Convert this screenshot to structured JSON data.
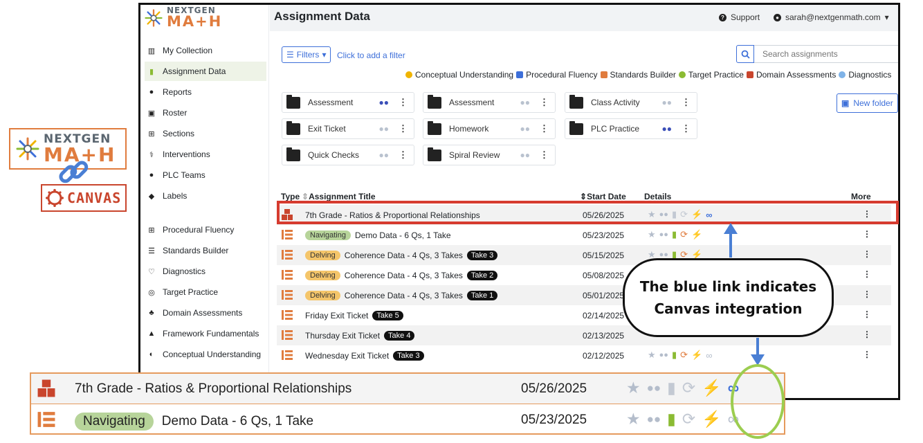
{
  "app": {
    "title": "Assignment Data",
    "support_label": "Support",
    "user_email": "sarah@nextgenmath.com",
    "caret": "▾"
  },
  "branding": {
    "ngm_top": "NEXTGEN",
    "ngm_bottom": "MA+H",
    "canvas": "CANVAS"
  },
  "sidebar": {
    "items": [
      {
        "label": "My Collection",
        "icon": "collection-icon"
      },
      {
        "label": "Assignment Data",
        "icon": "bar-chart-icon"
      },
      {
        "label": "Reports",
        "icon": "magnifier-icon"
      },
      {
        "label": "Roster",
        "icon": "roster-icon"
      },
      {
        "label": "Sections",
        "icon": "sections-icon"
      },
      {
        "label": "Interventions",
        "icon": "interventions-icon"
      },
      {
        "label": "PLC Teams",
        "icon": "team-icon"
      },
      {
        "label": "Labels",
        "icon": "tag-icon"
      },
      {
        "label": "Procedural Fluency",
        "icon": "grid-icon"
      },
      {
        "label": "Standards Builder",
        "icon": "list-icon"
      },
      {
        "label": "Diagnostics",
        "icon": "diagnostics-icon"
      },
      {
        "label": "Target Practice",
        "icon": "target-icon"
      },
      {
        "label": "Domain Assessments",
        "icon": "shapes-icon"
      },
      {
        "label": "Framework Fundamentals",
        "icon": "pyramid-icon"
      },
      {
        "label": "Conceptual Understanding",
        "icon": "bulb-icon"
      }
    ]
  },
  "toolbar": {
    "filters_label": "Filters",
    "filter_hint": "Click to add a filter",
    "search_placeholder": "Search assignments",
    "new_folder_label": "New folder"
  },
  "legend": [
    {
      "label": "Conceptual Understanding",
      "color": "#f0b400"
    },
    {
      "label": "Procedural Fluency",
      "color": "#3d6fd9"
    },
    {
      "label": "Standards Builder",
      "color": "#e07c3e"
    },
    {
      "label": "Target Practice",
      "color": "#8bbb33"
    },
    {
      "label": "Domain Assessments",
      "color": "#c9452d"
    },
    {
      "label": "Diagnostics",
      "color": "#7fb3e8"
    }
  ],
  "folders": [
    {
      "label": "Assessment",
      "shared": true
    },
    {
      "label": "Assessment",
      "shared": false
    },
    {
      "label": "Class Activity",
      "shared": false
    },
    {
      "label": "Exit Ticket",
      "shared": false
    },
    {
      "label": "Homework",
      "shared": false
    },
    {
      "label": "PLC Practice",
      "shared": true
    },
    {
      "label": "Quick Checks",
      "shared": false
    },
    {
      "label": "Spiral Review",
      "shared": false
    }
  ],
  "table": {
    "headers": {
      "type": "Type",
      "title": "Assignment Title",
      "start_date": "Start Date",
      "details": "Details",
      "more": "More"
    },
    "rows": [
      {
        "type": "domain",
        "level": "",
        "title": "7th Grade - Ratios & Proportional Relationships",
        "take": "",
        "date": "05/26/2025",
        "linked": true
      },
      {
        "type": "standards",
        "level": "Navigating",
        "title": "Demo Data - 6 Qs, 1 Take",
        "take": "",
        "date": "05/23/2025",
        "linked": false
      },
      {
        "type": "standards",
        "level": "Delving",
        "title": "Coherence Data - 4 Qs, 3 Takes",
        "take": "Take 3",
        "date": "05/15/2025",
        "linked": false
      },
      {
        "type": "standards",
        "level": "Delving",
        "title": "Coherence Data - 4 Qs, 3 Takes",
        "take": "Take 2",
        "date": "05/08/2025",
        "linked": false
      },
      {
        "type": "standards",
        "level": "Delving",
        "title": "Coherence Data - 4 Qs, 3 Takes",
        "take": "Take 1",
        "date": "05/01/2025",
        "linked": false
      },
      {
        "type": "standards",
        "level": "",
        "title": "Friday Exit Ticket",
        "take": "Take 5",
        "date": "02/14/2025",
        "linked": false
      },
      {
        "type": "standards",
        "level": "",
        "title": "Thursday Exit Ticket",
        "take": "Take 4",
        "date": "02/13/2025",
        "linked": false
      },
      {
        "type": "standards",
        "level": "",
        "title": "Wednesday Exit Ticket",
        "take": "Take 3",
        "date": "02/12/2025",
        "linked": false
      }
    ]
  },
  "callout": {
    "line1": "The blue link indicates",
    "line2": "Canvas integration"
  },
  "zoom": {
    "row1": {
      "title": "7th Grade - Ratios & Proportional Relationships",
      "date": "05/26/2025"
    },
    "row2": {
      "level": "Navigating",
      "title": "Demo Data - 6 Qs, 1 Take",
      "date": "05/23/2025"
    }
  }
}
